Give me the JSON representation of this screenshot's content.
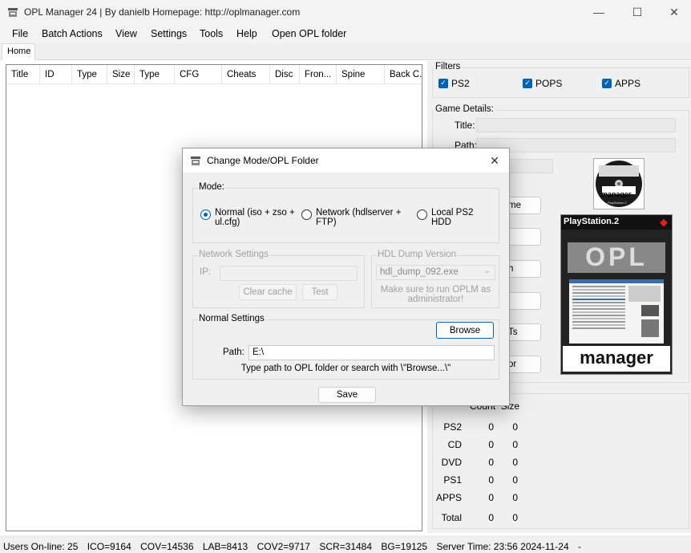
{
  "window": {
    "title": "OPL Manager 24 | By danielb Homepage: http://oplmanager.com",
    "minimize": "—",
    "maximize": "☐",
    "close": "✕"
  },
  "menu": [
    "File",
    "Batch Actions",
    "View",
    "Settings",
    "Tools",
    "Help",
    "Open OPL folder"
  ],
  "tabs": {
    "home": "Home"
  },
  "grid": {
    "columns": [
      "Title",
      "ID",
      "Type",
      "Size",
      "Type",
      "CFG",
      "Cheats",
      "Disc",
      "Fron...",
      "Spine",
      "Back C."
    ]
  },
  "filters": {
    "label": "Filters",
    "items": [
      {
        "label": "PS2",
        "checked": true
      },
      {
        "label": "POPS",
        "checked": true
      },
      {
        "label": "APPS",
        "checked": true
      }
    ]
  },
  "game_details": {
    "label": "Game Details:",
    "title_label": "Title:",
    "path_label": "Path:",
    "buttons_partial": [
      "me",
      "h",
      "Ts",
      "or"
    ]
  },
  "art": {
    "small_text": "manager",
    "small_sub": "PlayStation.2",
    "big_header": "PlayStation.2",
    "big_logo": "OPL",
    "big_footer": "manager"
  },
  "stats": {
    "headers": [
      "Count",
      "Size"
    ],
    "rows": [
      {
        "label": "PS2",
        "count": "0",
        "size": "0"
      },
      {
        "label": "CD",
        "count": "0",
        "size": "0"
      },
      {
        "label": "DVD",
        "count": "0",
        "size": "0"
      },
      {
        "label": "PS1",
        "count": "0",
        "size": "0"
      },
      {
        "label": "APPS",
        "count": "0",
        "size": "0"
      },
      {
        "label": "Total",
        "count": "0",
        "size": "0"
      }
    ]
  },
  "status": {
    "users": "Users On-line: 25",
    "ico": "ICO=9164",
    "cov": "COV=14536",
    "lab": "LAB=8413",
    "cov2": "COV2=9717",
    "scr": "SCR=31484",
    "bg": "BG=19125",
    "server_time": "Server Time: 23:56 2024-11-24",
    "dash": "-"
  },
  "dialog": {
    "title": "Change Mode/OPL Folder",
    "close": "✕",
    "mode_label": "Mode:",
    "modes": [
      {
        "label": "Normal (iso + zso + ul.cfg)",
        "selected": true
      },
      {
        "label": "Network (hdlserver + FTP)",
        "selected": false
      },
      {
        "label": "Local PS2 HDD",
        "selected": false
      }
    ],
    "network": {
      "label": "Network Settings",
      "ip_label": "IP:",
      "ip_value": "",
      "clear_cache": "Clear cache",
      "test": "Test"
    },
    "hdl": {
      "label": "HDL Dump Version",
      "selected": "hdl_dump_092.exe",
      "note": "Make sure to run OPLM as administrator!"
    },
    "normal": {
      "label": "Normal Settings",
      "browse": "Browse",
      "path_label": "Path:",
      "path_value": "E:\\",
      "hint": "Type path to OPL folder or search with \\\"Browse...\\\""
    },
    "save": "Save"
  },
  "colors": {
    "accent": "#0063b1",
    "window_bg": "#f0f0f0"
  }
}
